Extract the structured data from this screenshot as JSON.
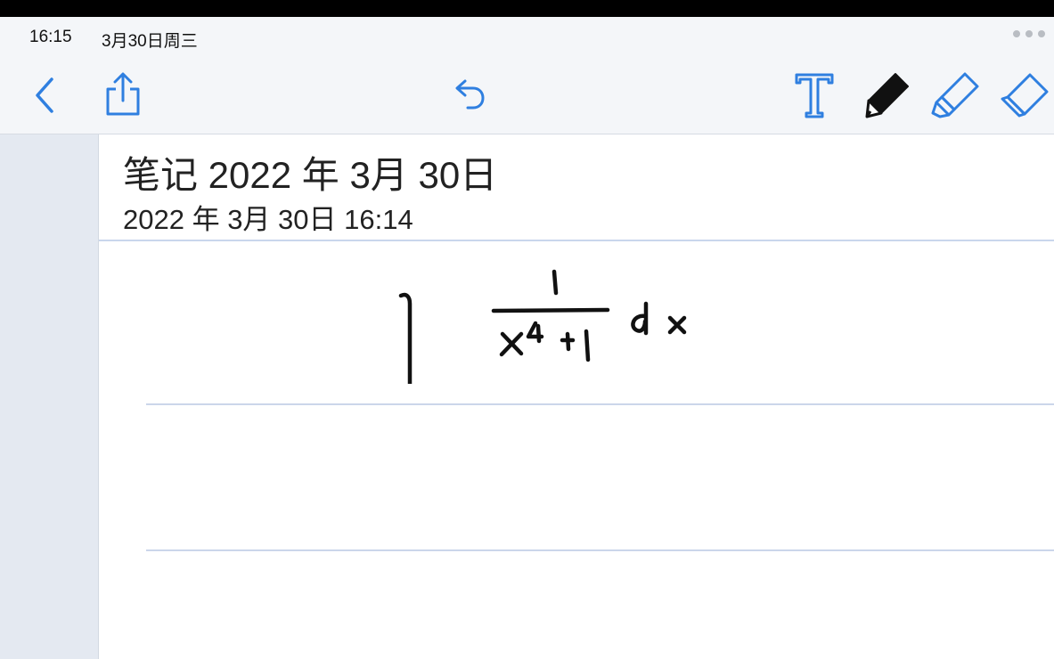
{
  "status_bar": {
    "time": "16:15",
    "date": "3月30日周三",
    "more_icon": "ellipsis-icon"
  },
  "toolbar": {
    "left": [
      "back-chevron-icon",
      "share-icon"
    ],
    "center": [
      "undo-icon"
    ],
    "right": [
      "text-tool-icon",
      "pen-tool-icon",
      "highlighter-tool-icon",
      "eraser-tool-icon"
    ],
    "accent_color": "#2f7fe0"
  },
  "note": {
    "title": "笔记 2022 年 3月 30日",
    "created": "2022 年 3月 30日 16:14",
    "handwriting_content": "∫ 1/(x⁴+1) dx"
  },
  "colors": {
    "background": "#f4f6f9",
    "page": "#ffffff",
    "sidebar": "#e4e9f1",
    "rule_line": "#cbd6ea",
    "ink": "#111111"
  }
}
